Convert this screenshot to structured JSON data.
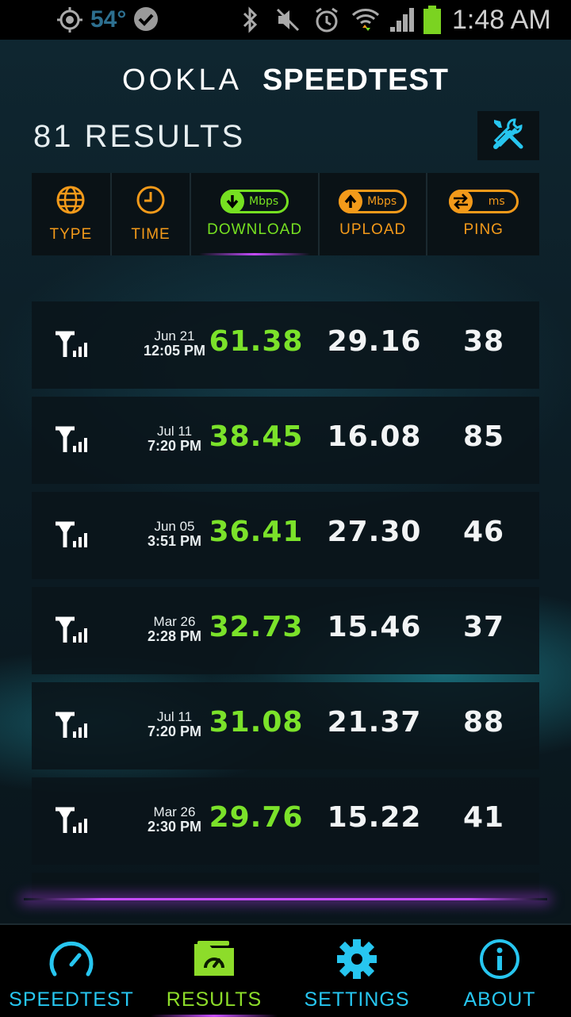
{
  "status_bar": {
    "temperature": "54°",
    "time": "1:48 AM"
  },
  "header": {
    "brand": "OOKLA",
    "product": "SPEEDTEST"
  },
  "results_count": "81 RESULTS",
  "columns": {
    "type": "TYPE",
    "time": "TIME",
    "download": "DOWNLOAD",
    "download_unit": "Mbps",
    "upload": "UPLOAD",
    "upload_unit": "Mbps",
    "ping": "PING",
    "ping_unit": "ms"
  },
  "rows": [
    {
      "date": "Jun 21",
      "time": "12:05 PM",
      "download": "61.38",
      "upload": "29.16",
      "ping": "38"
    },
    {
      "date": "Jul 11",
      "time": "7:20 PM",
      "download": "38.45",
      "upload": "16.08",
      "ping": "85"
    },
    {
      "date": "Jun 05",
      "time": "3:51 PM",
      "download": "36.41",
      "upload": "27.30",
      "ping": "46"
    },
    {
      "date": "Mar 26",
      "time": "2:28 PM",
      "download": "32.73",
      "upload": "15.46",
      "ping": "37"
    },
    {
      "date": "Jul 11",
      "time": "7:20 PM",
      "download": "31.08",
      "upload": "21.37",
      "ping": "88"
    },
    {
      "date": "Mar 26",
      "time": "2:30 PM",
      "download": "29.76",
      "upload": "15.22",
      "ping": "41"
    }
  ],
  "nav": {
    "speedtest": "SPEEDTEST",
    "results": "RESULTS",
    "settings": "SETTINGS",
    "about": "ABOUT"
  },
  "colors": {
    "accent_orange": "#f39a1a",
    "accent_green": "#76e021",
    "accent_cyan": "#27c6f0",
    "accent_purple": "#c64cff"
  }
}
